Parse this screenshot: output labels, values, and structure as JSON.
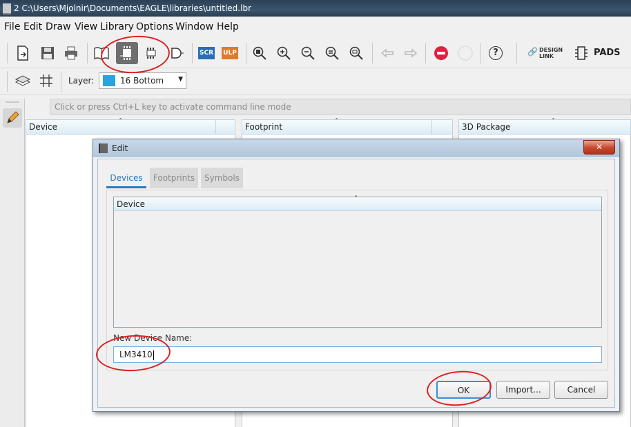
{
  "window": {
    "title": "2 C:\\Users\\Mjolnir\\Documents\\EAGLE\\libraries\\untitled.lbr"
  },
  "menu": [
    "File",
    "Edit",
    "Draw",
    "View",
    "Library",
    "Options",
    "Window",
    "Help"
  ],
  "toolbar": {
    "scr_label": "SCR",
    "ulp_label": "ULP",
    "design_link": "DESIGN LINK",
    "pads": "PADS",
    "help_glyph": "?"
  },
  "toolbar2": {
    "layer_label": "Layer:",
    "layer_value": "16 Bottom",
    "layer_color": "#2aa3df"
  },
  "commandline": {
    "placeholder": "Click or press Ctrl+L key to activate command line mode"
  },
  "columns": [
    "Device",
    "Footprint",
    "3D Package"
  ],
  "dialog": {
    "title": "Edit",
    "tabs": [
      "Devices",
      "Footprints",
      "Symbols"
    ],
    "list_header": "Device",
    "name_label": "New Device Name:",
    "name_value": "LM3410",
    "buttons": {
      "ok": "OK",
      "import": "Import...",
      "cancel": "Cancel"
    }
  },
  "colors": {
    "accent": "#2a7ab9",
    "annotation": "#e02020",
    "stop": "#e02040"
  }
}
